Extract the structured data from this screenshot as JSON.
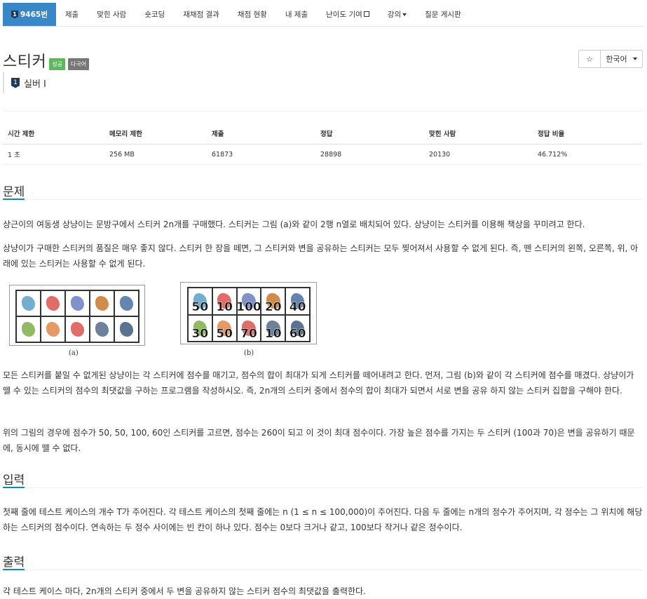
{
  "nav": {
    "problem_number": "9465번",
    "tier_icon_glyph": "1",
    "items": [
      "제출",
      "맞힌 사람",
      "숏코딩",
      "재채점 결과",
      "채점 현황",
      "내 제출",
      "난이도 기여",
      "강의",
      "질문 게시판"
    ]
  },
  "problem": {
    "title": "스티커",
    "badges": [
      "성공",
      "다국어"
    ],
    "tier": "실버 I",
    "tier_glyph": "1",
    "star": "☆",
    "language": "한국어"
  },
  "info_table": {
    "headers": [
      "시간 제한",
      "메모리 제한",
      "제출",
      "정답",
      "맞힌 사람",
      "정답 비율"
    ],
    "row": [
      "1 초",
      "256 MB",
      "61873",
      "28898",
      "20130",
      "46.712%"
    ]
  },
  "sections": {
    "problem_heading": "문제",
    "problem_p1": "상근이의 여동생 상냥이는 문방구에서 스티커 2n개를 구매했다. 스티커는 그림 (a)와 같이 2행 n열로 배치되어 있다. 상냥이는 스티커를 이용해 책상을 꾸미려고 한다.",
    "problem_p2": "상냥이가 구매한 스티커의 품질은 매우 좋지 않다. 스티커 한 장을 떼면, 그 스티커와 변을 공유하는 스티커는 모두 찢어져서 사용할 수 없게 된다. 즉, 뗀 스티커의 왼쪽, 오른쪽, 위, 아래에 있는 스티커는 사용할 수 없게 된다.",
    "problem_p3": "모든 스티커를 붙일 수 없게된 상냥이는 각 스티커에 점수를 매기고, 점수의 합이 최대가 되게 스티커를 떼어내려고 한다. 먼저, 그림 (b)와 같이 각 스티커에 점수를 매겼다. 상냥이가 뗄 수 있는 스티커의 점수의 최댓값을 구하는 프로그램을 작성하시오. 즉, 2n개의 스티커 중에서 점수의 합이 최대가 되면서 서로 변을 공유 하지 않는 스티커 집합을 구해야 한다.",
    "problem_p4": "위의 그림의 경우에 점수가 50, 50, 100, 60인 스티커를 고르면, 점수는 260이 되고 이 것이 최대 점수이다. 가장 높은 점수를 가지는 두 스티커 (100과 70)은 변을 공유하기 때문에, 동시에 뗄 수 없다.",
    "input_heading": "입력",
    "input_p": "첫째 줄에 테스트 케이스의 개수 T가 주어진다. 각 테스트 케이스의 첫째 줄에는 n (1 ≤ n ≤ 100,000)이 주어진다. 다음 두 줄에는 n개의 정수가 주어지며, 각 정수는 그 위치에 해당하는 스티커의 점수이다. 연속하는 두 정수 사이에는 빈 칸이 하나 있다. 점수는 0보다 크거나 같고, 100보다 작거나 같은 정수이다.",
    "output_heading": "출력",
    "output_p": "각 테스트 케이스 마다, 2n개의 스티커 중에서 두 변을 공유하지 않는 스티커 점수의 최댓값을 출력한다."
  },
  "figure": {
    "caption_a": "(a)",
    "caption_b": "(b)",
    "scores_top": [
      "50",
      "10",
      "100",
      "20",
      "40"
    ],
    "scores_bottom": [
      "30",
      "50",
      "70",
      "10",
      "60"
    ],
    "sticker_colors_top": [
      "#5aa0c8",
      "#d9534f",
      "#6a7fbf",
      "#c8782a",
      "#4a6fa0"
    ],
    "sticker_colors_bottom": [
      "#7fae4a",
      "#e0874a",
      "#d9534f",
      "#556b8a",
      "#3d5a80"
    ]
  }
}
